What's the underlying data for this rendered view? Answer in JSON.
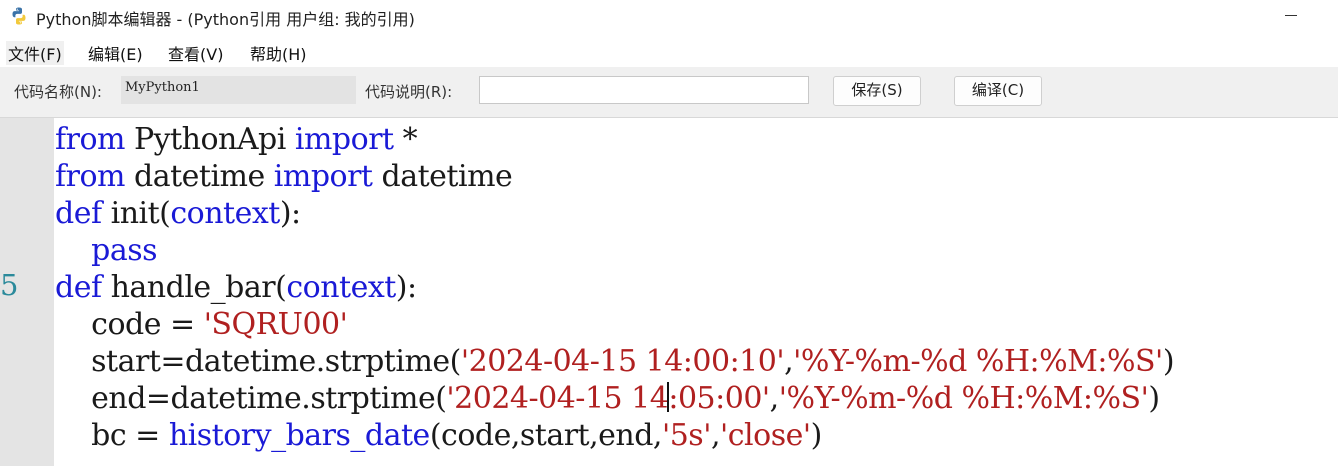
{
  "window": {
    "title": "Python脚本编辑器 - (Python引用 用户组: 我的引用)"
  },
  "menu": {
    "file": "文件(F)",
    "edit": "编辑(E)",
    "view": "查看(V)",
    "help": "帮助(H)"
  },
  "toolbar": {
    "name_label": "代码名称(N):",
    "name_value": "MyPython1",
    "desc_label": "代码说明(R):",
    "desc_value": "",
    "save_label": "保存(S)",
    "compile_label": "编译(C)"
  },
  "editor": {
    "visible_line_number": "5",
    "lines": [
      [
        {
          "t": "from",
          "c": "kw"
        },
        {
          "t": " PythonApi "
        },
        {
          "t": "import",
          "c": "kw"
        },
        {
          "t": " *"
        }
      ],
      [
        {
          "t": "from",
          "c": "kw"
        },
        {
          "t": " datetime "
        },
        {
          "t": "import",
          "c": "kw"
        },
        {
          "t": " datetime"
        }
      ],
      [
        {
          "t": "def",
          "c": "kw"
        },
        {
          "t": " init("
        },
        {
          "t": "context",
          "c": "kw"
        },
        {
          "t": "):"
        }
      ],
      [
        {
          "t": "    "
        },
        {
          "t": "pass",
          "c": "kw"
        }
      ],
      [
        {
          "t": "def",
          "c": "kw"
        },
        {
          "t": " handle_bar("
        },
        {
          "t": "context",
          "c": "kw"
        },
        {
          "t": "):"
        }
      ],
      [
        {
          "t": "    code = "
        },
        {
          "t": "'SQRU00'",
          "c": "str"
        }
      ],
      [
        {
          "t": "    start=datetime.strptime("
        },
        {
          "t": "'2024-04-15 14:00:10'",
          "c": "str"
        },
        {
          "t": ","
        },
        {
          "t": "'%Y-%m-%d %H:%M:%S'",
          "c": "str"
        },
        {
          "t": ")"
        }
      ],
      [
        {
          "t": "    end=datetime.strptime("
        },
        {
          "t": "'2024-04-15 14",
          "c": "str"
        },
        {
          "t": "",
          "c": "caret"
        },
        {
          "t": ":05:00'",
          "c": "str"
        },
        {
          "t": ","
        },
        {
          "t": "'%Y-%m-%d %H:%M:%S'",
          "c": "str"
        },
        {
          "t": ")"
        }
      ],
      [
        {
          "t": "    bc = "
        },
        {
          "t": "history_bars_date",
          "c": "kw"
        },
        {
          "t": "(code,start,end,"
        },
        {
          "t": "'5s'",
          "c": "str"
        },
        {
          "t": ","
        },
        {
          "t": "'close'",
          "c": "str"
        },
        {
          "t": ")"
        }
      ]
    ]
  }
}
